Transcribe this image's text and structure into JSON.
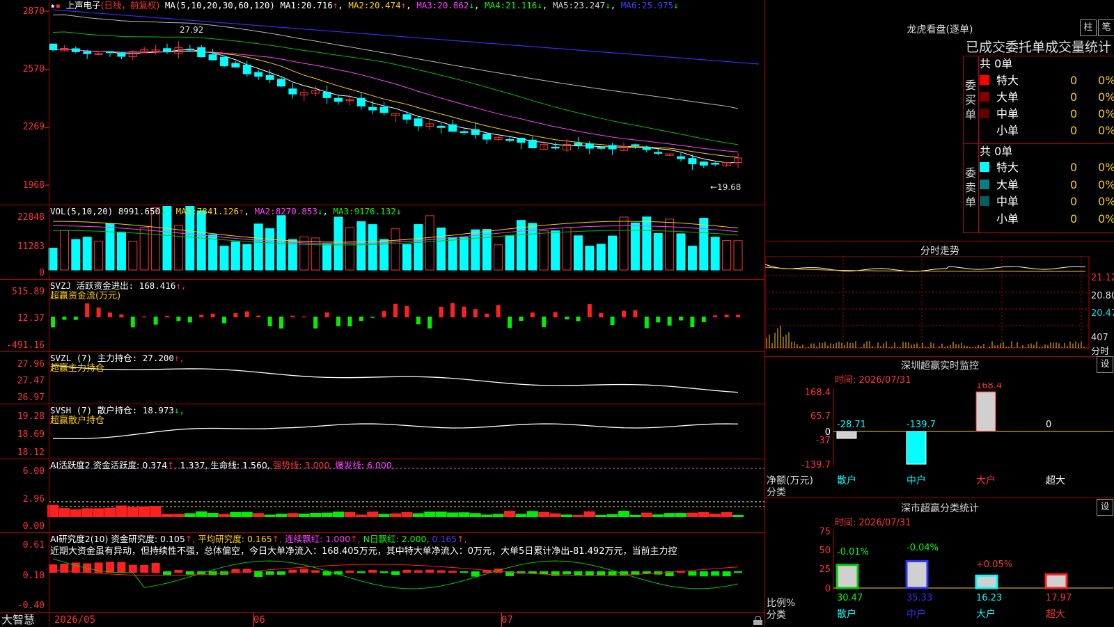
{
  "stock": {
    "name": "上声电子",
    "period": "(日线，前复权)"
  },
  "colors": {
    "up": "#ff3333",
    "down": "#00ffff",
    "grid": "#c00000",
    "ma1": "#ffffff",
    "ma2": "#ffd000",
    "ma3": "#ff40ff",
    "ma4": "#00c000",
    "ma5": "#bbbbbb",
    "ma6": "#3030ff"
  },
  "price_pane": {
    "ma_label": "MA(5,10,20,30,60,120)",
    "ma_values": [
      {
        "label": "MA1:",
        "value": "20.716",
        "arrow": "↑"
      },
      {
        "label": "MA2:",
        "value": "20.474",
        "arrow": "↑"
      },
      {
        "label": "MA3:",
        "value": "20.862",
        "arrow": "↓"
      },
      {
        "label": "MA4:",
        "value": "21.116",
        "arrow": "↓"
      },
      {
        "label": "MA5:",
        "value": "23.247",
        "arrow": "↓"
      },
      {
        "label": "MA6:",
        "value": "25.975",
        "arrow": "↓"
      }
    ],
    "y_ticks": [
      "2870",
      "2570",
      "2269",
      "1968"
    ],
    "high_label": "27.92",
    "low_label": "←19.68"
  },
  "volume_pane": {
    "label": "VOL(5,10,20)",
    "value": "8991.650",
    "arrow": "↓",
    "ma_values": [
      {
        "label": "MA1:",
        "value": "7841.126",
        "arrow": "↑"
      },
      {
        "label": "MA2:",
        "value": "8270.853",
        "arrow": "↓"
      },
      {
        "label": "MA3:",
        "value": "9176.132",
        "arrow": "↓"
      }
    ],
    "y_ticks": [
      "22848",
      "11283",
      "0"
    ]
  },
  "svzj_pane": {
    "label": "SVZJ  活跃资金进出:",
    "value": "168.416",
    "arrow": "↑,",
    "sub": "超赢资金流(万元)",
    "y_ticks": [
      "515.89",
      "12.37",
      "-491.16"
    ]
  },
  "svzl_pane": {
    "label": "SVZL (7) 主力持仓:",
    "value": "27.200",
    "arrow": "↑,",
    "sub": "超赢主力持仓",
    "y_ticks": [
      "27.96",
      "27.47",
      "26.97"
    ]
  },
  "svsh_pane": {
    "label": "SVSH (7) 散户持仓:",
    "value": "18.973",
    "arrow": "↓,",
    "sub": "超赢散户持仓",
    "y_ticks": [
      "19.28",
      "18.69",
      "18.12"
    ]
  },
  "ai_active_pane": {
    "label": "AI活跃度2 资金活跃度:",
    "v1": "0.374",
    "a1": "↑,",
    "v2": "1.337,",
    "life_label": "生命线:",
    "life": "1.560,",
    "strong_label": "强势线:",
    "strong": "3.000,",
    "burst_label": "爆发线:",
    "burst": "6.000,",
    "y_ticks": [
      "6.00",
      "2.96",
      "0.00"
    ]
  },
  "ai_research_pane": {
    "label": "AI研究度2(10) 资金研究度:",
    "v1": "0.105",
    "a1": "↑,",
    "avg_label": "平均研究度:",
    "avg": "0.165",
    "a2": "↑,",
    "cont_label": "连续飘红:",
    "cont": "1.000",
    "a3": "↑,",
    "nday_label": "N日飘红:",
    "nday": "2.000,",
    "last": "0.165",
    "a4": "↑,",
    "commentary": "近期大资金虽有异动，但持续性不强，总体偏空，今日大单净流入：168.405万元，其中特大单净流入：0万元，大单5日累计净出-81.492万元，当前主力控",
    "y_ticks": [
      "0.61",
      "0.10",
      "-0.40"
    ]
  },
  "bottom_bar": {
    "logo": "大智慧",
    "dates": [
      "2026/05",
      "06",
      "07"
    ]
  },
  "right_panel": {
    "dragon_tiger_title": "龙虎看盘(逐单)",
    "btn_bar": "柱",
    "btn_note": "笔",
    "stat_title": "已成交委托单成交量统计",
    "buy": {
      "side_label": "委买单",
      "total": "共 0单",
      "rows": [
        {
          "name": "特大",
          "vol": "0",
          "pct": "0%"
        },
        {
          "name": "大单",
          "vol": "0",
          "pct": "0%"
        },
        {
          "name": "中单",
          "vol": "0",
          "pct": "0%"
        },
        {
          "name": "小单",
          "vol": "0",
          "pct": "0%"
        }
      ]
    },
    "sell": {
      "side_label": "委卖单",
      "total": "共 0单",
      "rows": [
        {
          "name": "特大",
          "vol": "0",
          "pct": "0%"
        },
        {
          "name": "大单",
          "vol": "0",
          "pct": "0%"
        },
        {
          "name": "中单",
          "vol": "0",
          "pct": "0%"
        },
        {
          "name": "小单",
          "vol": "0",
          "pct": "0%"
        }
      ]
    },
    "intraday_title": "分时走势",
    "intraday_ticks": [
      "21.12",
      "20.80",
      "20.47"
    ],
    "intraday_vol": "407",
    "intraday_vol_unit": "分时",
    "monitor_title": "深圳超赢实时监控",
    "monitor_time": "时间: 2026/07/31",
    "set_label": "设",
    "monitor_ticks": [
      "168.4",
      "65.7",
      "0",
      "-37",
      "-139.7"
    ],
    "monitor_values": [
      "-28.71",
      "-139.7",
      "168.4",
      "0"
    ],
    "monitor_side_label": "净额(万元)",
    "monitor_cat_label": "分类",
    "categories": [
      "散户",
      "中户",
      "大户",
      "超大"
    ],
    "class_title": "深市超赢分类统计",
    "class_time": "时间: 2026/07/31",
    "class_ticks": [
      "75",
      "50",
      "25",
      "0"
    ],
    "class_changes": [
      "-0.01%",
      "-0.04%",
      "+0.05%",
      ""
    ],
    "class_values": [
      "30.47",
      "35.33",
      "16.23",
      "17.97"
    ],
    "class_side_label": "比例%",
    "class_cat_label": "分类"
  }
}
